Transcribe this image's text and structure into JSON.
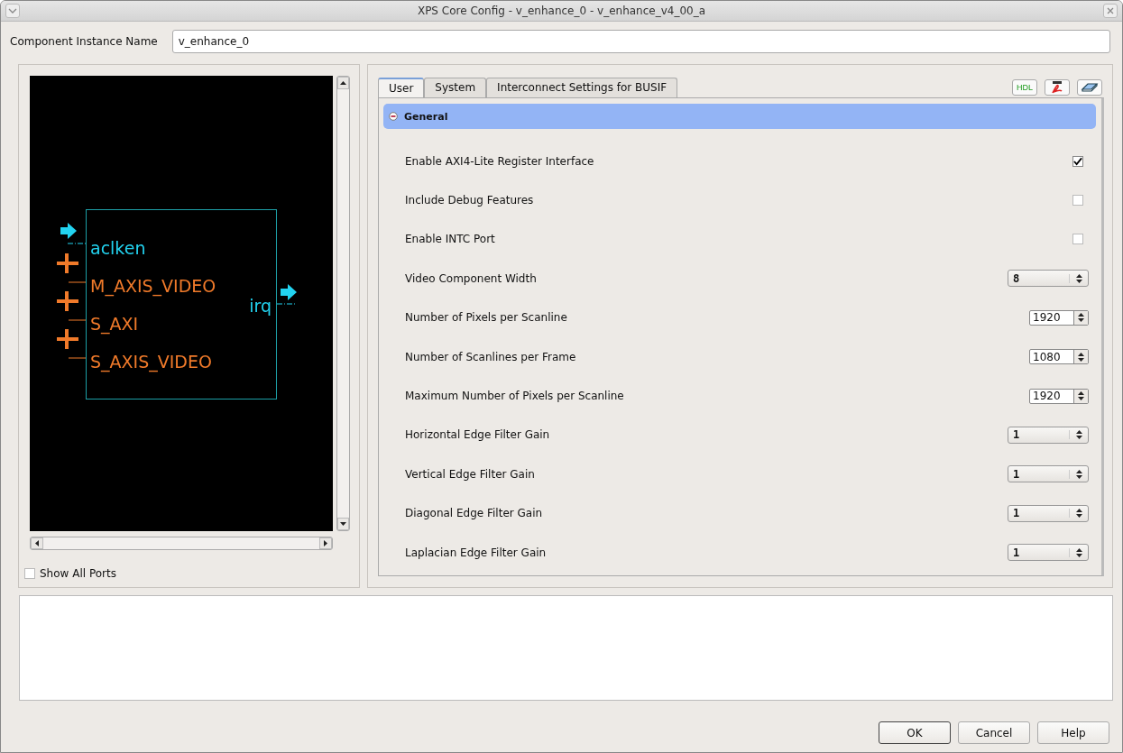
{
  "window": {
    "title": "XPS Core Config - v_enhance_0 - v_enhance_v4_00_a"
  },
  "instance": {
    "label": "Component Instance Name",
    "value": "v_enhance_0"
  },
  "diagram": {
    "left_ports": [
      {
        "name": "aclken",
        "kind": "clock"
      },
      {
        "name": "M_AXIS_VIDEO",
        "kind": "bus"
      },
      {
        "name": "S_AXI",
        "kind": "bus"
      },
      {
        "name": "S_AXIS_VIDEO",
        "kind": "bus"
      }
    ],
    "right_ports": [
      {
        "name": "irq",
        "kind": "clock"
      }
    ]
  },
  "show_all_ports": {
    "label": "Show All Ports",
    "checked": false
  },
  "tabs": [
    {
      "label": "User",
      "selected": true
    },
    {
      "label": "System",
      "selected": false
    },
    {
      "label": "Interconnect Settings for BUSIF",
      "selected": false
    }
  ],
  "tool_buttons": [
    {
      "kind": "hdl",
      "label": "HDL"
    },
    {
      "kind": "pdf"
    },
    {
      "kind": "link"
    }
  ],
  "section": {
    "title": "General",
    "expanded": true
  },
  "params": [
    {
      "label": "Enable AXI4-Lite Register Interface",
      "kind": "checkbox",
      "checked": true
    },
    {
      "label": "Include Debug Features",
      "kind": "checkbox",
      "checked": false
    },
    {
      "label": "Enable INTC Port",
      "kind": "checkbox",
      "checked": false
    },
    {
      "label": "Video Component Width",
      "kind": "combo",
      "value": "8"
    },
    {
      "label": "Number of Pixels per Scanline",
      "kind": "spin",
      "value": "1920"
    },
    {
      "label": "Number of Scanlines per Frame",
      "kind": "spin",
      "value": "1080"
    },
    {
      "label": "Maximum Number of Pixels per Scanline",
      "kind": "spin",
      "value": "1920"
    },
    {
      "label": "Horizontal Edge Filter Gain",
      "kind": "combo",
      "value": "1"
    },
    {
      "label": "Vertical Edge Filter Gain",
      "kind": "combo",
      "value": "1"
    },
    {
      "label": "Diagonal Edge Filter Gain",
      "kind": "combo",
      "value": "1"
    },
    {
      "label": "Laplacian Edge Filter Gain",
      "kind": "combo",
      "value": "1"
    }
  ],
  "buttons": [
    "OK",
    "Cancel",
    "Help"
  ]
}
